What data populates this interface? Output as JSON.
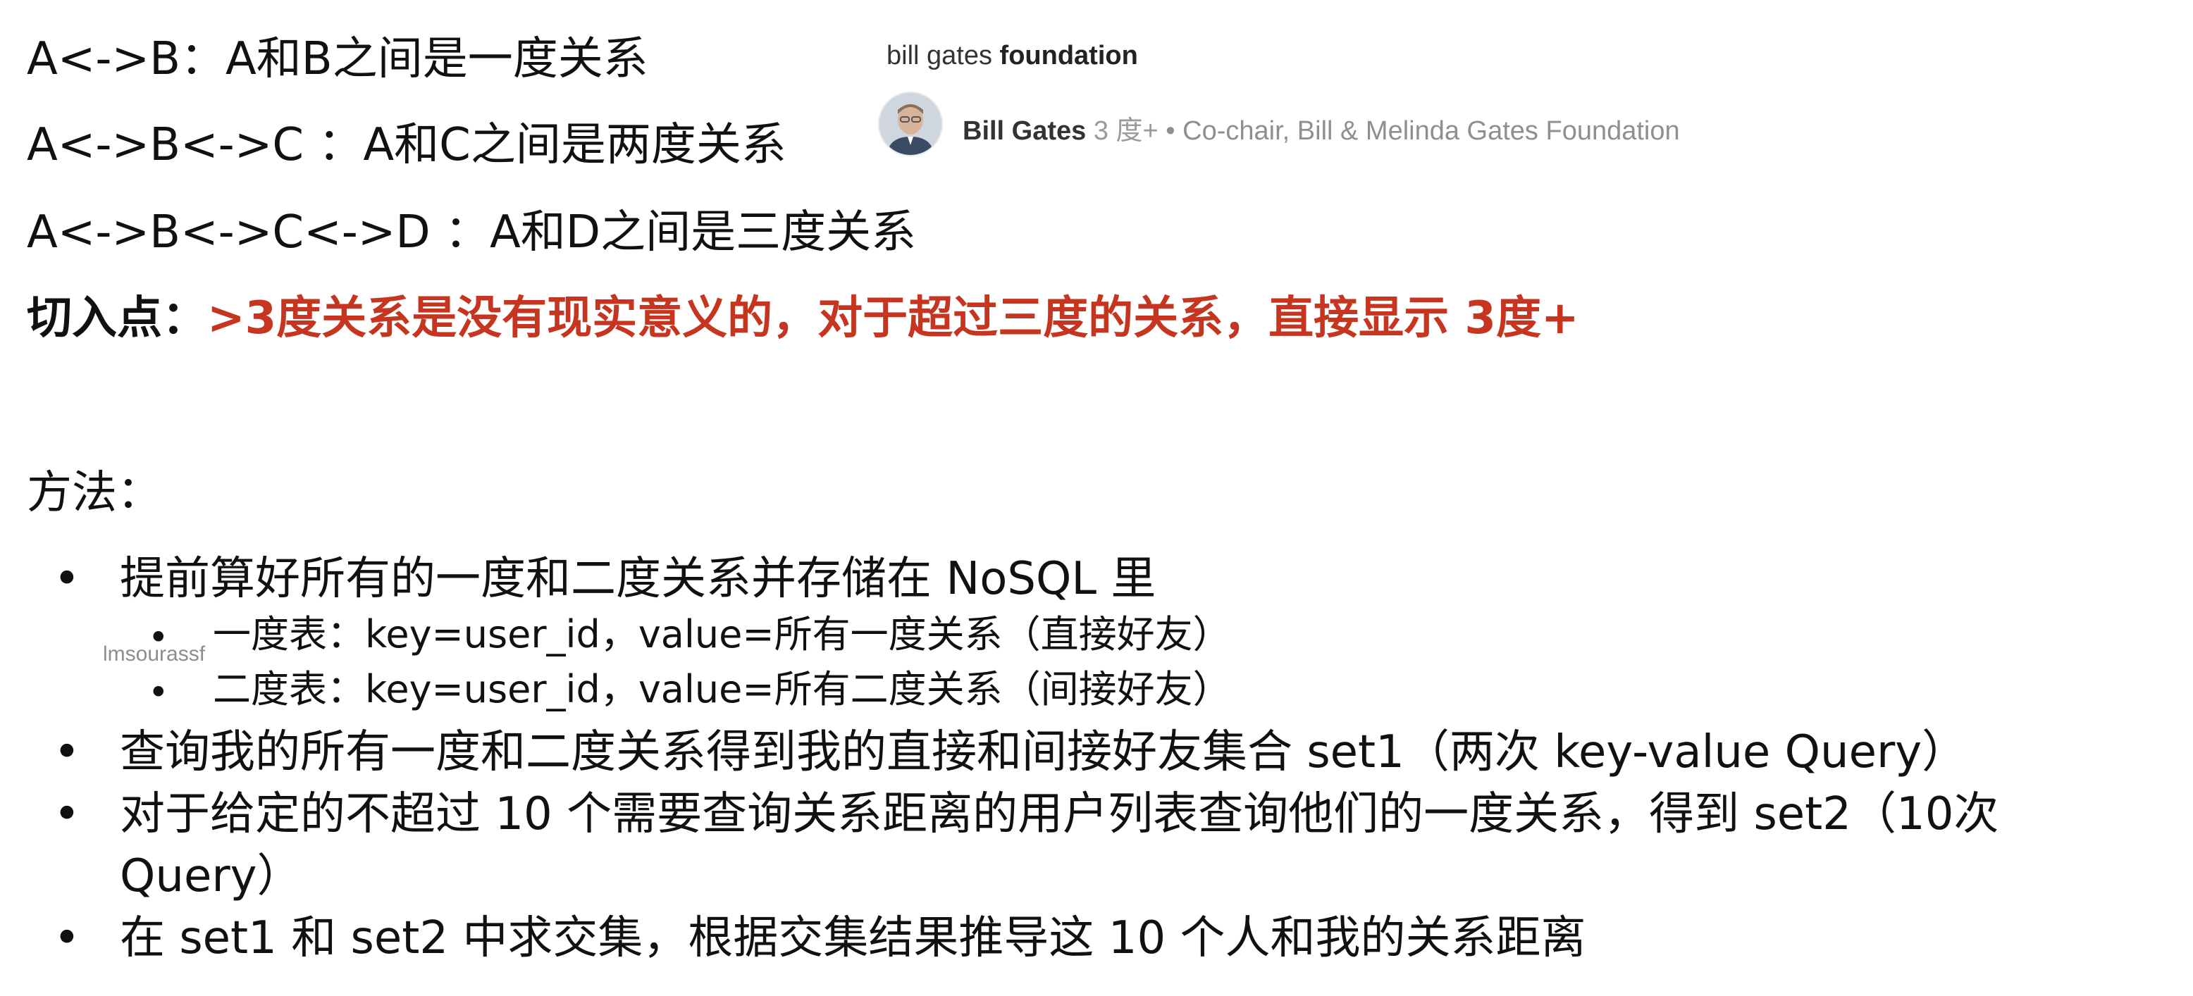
{
  "relations": {
    "line1": "A<->B：A和B之间是一度关系",
    "line2": "A<->B<->C ：A和C之间是两度关系",
    "line3": "A<->B<->C<->D ：A和D之间是三度关系"
  },
  "entry_point": {
    "label": "切入点：",
    "text": ">3度关系是没有现实意义的，对于超过三度的关系，直接显示 3度+"
  },
  "methods_heading": "方法：",
  "methods": {
    "b1": "提前算好所有的一度和二度关系并存储在 NoSQL 里",
    "s1": "一度表：key=user_id，value=所有一度关系（直接好友）",
    "s2": "二度表：key=user_id，value=所有二度关系（间接好友）",
    "b2": "查询我的所有一度和二度关系得到我的直接和间接好友集合 set1（两次 key-value Query）",
    "b3_line1": "对于给定的不超过 10 个需要查询关系距离的用户列表查询他们的一度关系，得到 set2（10次",
    "b3_line2": "Query）",
    "b4": "在 set1 和 set2 中求交集，根据交集结果推导这 10 个人和我的关系距离"
  },
  "bullet_glyph": "•",
  "watermark": "lmsourassf",
  "card": {
    "org_prefix": "bill gates ",
    "org_bold": "foundation",
    "name": "Bill Gates",
    "degree": " 3 度+ ",
    "separator": "•",
    "title": " Co-chair, Bill & Melinda Gates Foundation"
  },
  "colors": {
    "accent_red": "#c6351f",
    "text": "#111111",
    "muted": "#8f8f8f"
  }
}
